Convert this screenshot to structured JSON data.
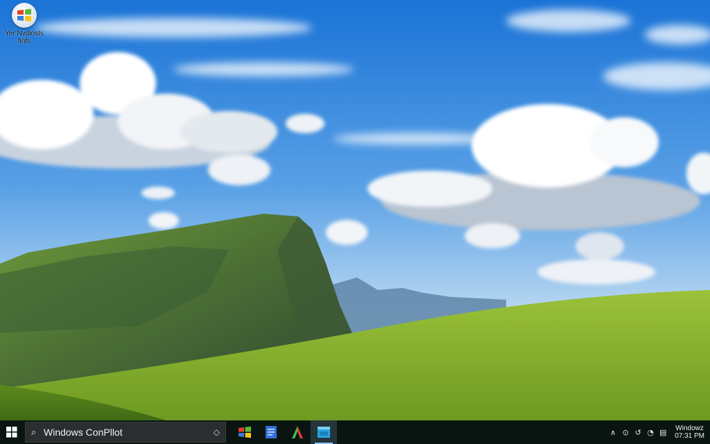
{
  "desktop": {
    "icons": [
      {
        "name": "windows-logo-icon",
        "label_line1": "Yer Nvdiosts",
        "label_line2": "finfs"
      }
    ]
  },
  "taskbar": {
    "start_icon": "windows-start-icon",
    "search": {
      "icon": "search-icon",
      "text": "Windows ConPllot",
      "end_icon": "diamond-icon"
    },
    "apps": [
      {
        "name": "windows-flag-app-icon",
        "active": false
      },
      {
        "name": "document-app-icon",
        "active": false
      },
      {
        "name": "green-red-a-app-icon",
        "active": false
      },
      {
        "name": "blue-window-app-icon",
        "active": true
      }
    ],
    "tray": {
      "icons": [
        "chevron-up-icon",
        "network-icon",
        "sync-icon",
        "volume-icon",
        "notification-icon"
      ],
      "clock_line1": "Windowz",
      "clock_line2": "07:31 PM"
    }
  }
}
